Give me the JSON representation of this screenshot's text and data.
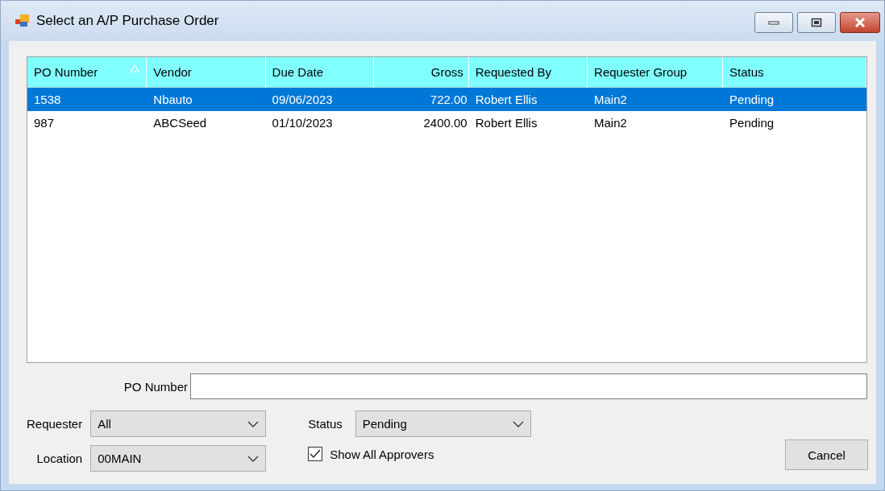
{
  "window": {
    "title": "Select an A/P Purchase Order"
  },
  "table": {
    "columns": [
      {
        "label": "PO Number",
        "kind": "text",
        "sorted": true
      },
      {
        "label": "Vendor",
        "kind": "text",
        "sorted": false
      },
      {
        "label": "Due Date",
        "kind": "text",
        "sorted": false
      },
      {
        "label": "Gross",
        "kind": "number",
        "sorted": false
      },
      {
        "label": "Requested By",
        "kind": "text",
        "sorted": false
      },
      {
        "label": "Requester Group",
        "kind": "text",
        "sorted": false
      },
      {
        "label": "Status",
        "kind": "text",
        "sorted": false
      }
    ],
    "rows": [
      {
        "selected": true,
        "cells": [
          "1538",
          "Nbauto",
          "09/06/2023",
          "722.00",
          "Robert Ellis",
          "Main2",
          "Pending"
        ]
      },
      {
        "selected": false,
        "cells": [
          "987",
          "ABCSeed",
          "01/10/2023",
          "2400.00",
          "Robert Ellis",
          "Main2",
          "Pending"
        ]
      }
    ]
  },
  "po_number": {
    "label": "PO Number"
  },
  "requester": {
    "label": "Requester",
    "value": "All"
  },
  "location": {
    "label": "Location",
    "value": "00MAIN"
  },
  "status": {
    "label": "Status",
    "value": "Pending"
  },
  "show_all_approvers": {
    "label": "Show All Approvers",
    "checked": true
  },
  "buttons": [
    "Cancel"
  ]
}
